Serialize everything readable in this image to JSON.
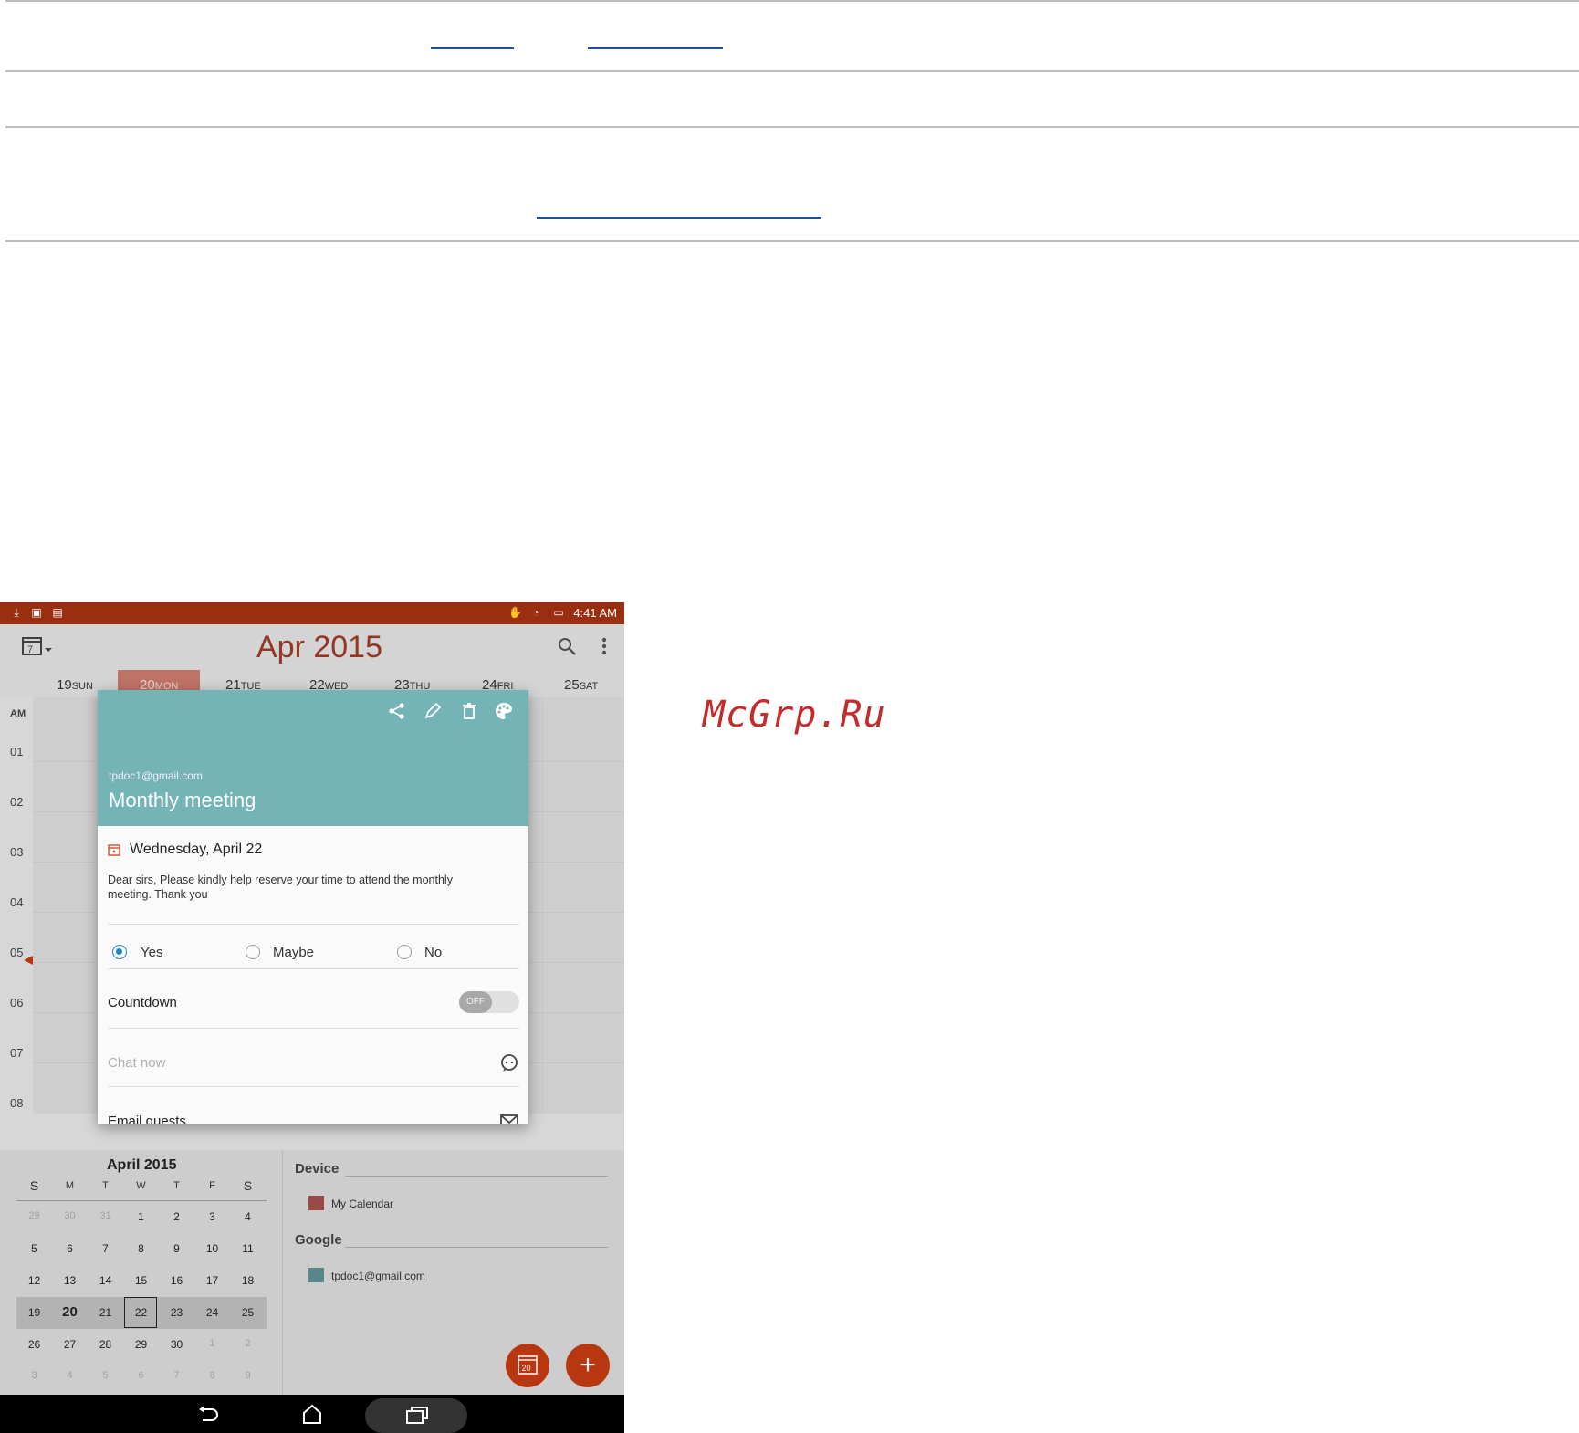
{
  "watermark": "McGrp.Ru",
  "status_bar": {
    "time": "4:41 AM"
  },
  "calendar": {
    "view_icon_number": "7",
    "month_title": "Apr 2015",
    "days": [
      {
        "num": "19",
        "name": "SUN"
      },
      {
        "num": "20",
        "name": "MON"
      },
      {
        "num": "21",
        "name": "TUE"
      },
      {
        "num": "22",
        "name": "WED"
      },
      {
        "num": "23",
        "name": "THU"
      },
      {
        "num": "24",
        "name": "FRI"
      },
      {
        "num": "25",
        "name": "SAT"
      }
    ],
    "hours": [
      "AM",
      "01",
      "02",
      "03",
      "04",
      "05",
      "06",
      "07",
      "08"
    ]
  },
  "event_popup": {
    "account": "tpdoc1@gmail.com",
    "title": "Monthly meeting",
    "date": "Wednesday, April 22",
    "description": "Dear sirs, Please kindly help reserve your time to attend the monthly meeting. Thank you",
    "rsvp": {
      "yes": "Yes",
      "maybe": "Maybe",
      "no": "No",
      "selected": "yes"
    },
    "countdown_label": "Countdown",
    "countdown_toggle": "OFF",
    "chat_placeholder": "Chat now",
    "email_label": "Email guests"
  },
  "mini_calendar": {
    "title": "April 2015",
    "weekdays": [
      "S",
      "M",
      "T",
      "W",
      "T",
      "F",
      "S"
    ],
    "weeks": [
      [
        "29",
        "30",
        "31",
        "1",
        "2",
        "3",
        "4"
      ],
      [
        "5",
        "6",
        "7",
        "8",
        "9",
        "10",
        "11"
      ],
      [
        "12",
        "13",
        "14",
        "15",
        "16",
        "17",
        "18"
      ],
      [
        "19",
        "20",
        "21",
        "22",
        "23",
        "24",
        "25"
      ],
      [
        "26",
        "27",
        "28",
        "29",
        "30",
        "1",
        "2"
      ],
      [
        "3",
        "4",
        "5",
        "6",
        "7",
        "8",
        "9"
      ]
    ]
  },
  "calendars": {
    "device_label": "Device",
    "device_item": "My Calendar",
    "device_color": "#a34f48",
    "google_label": "Google",
    "google_item": "tpdoc1@gmail.com",
    "google_color": "#5c8e93"
  },
  "fab": {
    "today_number": "20",
    "add_symbol": "+"
  },
  "colors": {
    "accent": "#c23a12",
    "header_teal": "#74b3b6",
    "status_bar": "#9a2e10"
  }
}
